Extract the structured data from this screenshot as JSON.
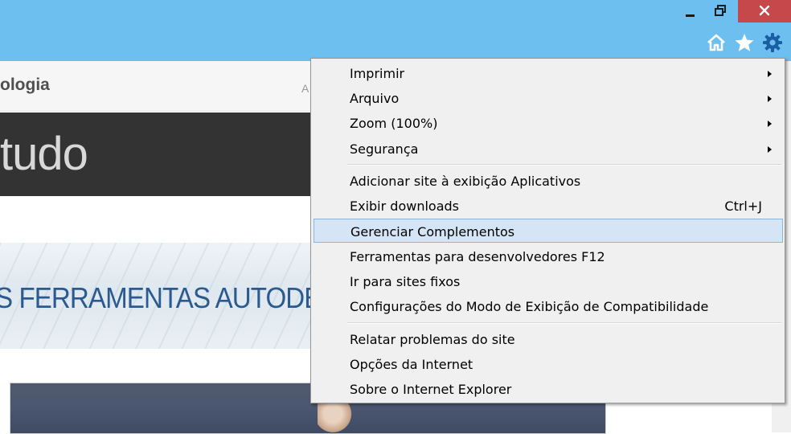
{
  "colors": {
    "titlebar": "#6cbfee",
    "close_button": "#c7484a",
    "menu_background": "#f0f0f0",
    "menu_highlight": "#d5e5f6",
    "banner_text": "#2a5a8f"
  },
  "window_controls": {
    "minimize_icon": "minimize-icon",
    "restore_icon": "restore-icon",
    "close_icon": "close-icon"
  },
  "command_bar": {
    "home_icon": "home-icon",
    "favorites_icon": "star-icon",
    "tools_icon": "gear-icon"
  },
  "page": {
    "brand_fragment": "ologia",
    "nav_fragment": "A",
    "dark_banner_text": "tudo",
    "ad_banner_text": "S FERRAMENTAS AUTODESK"
  },
  "menu": {
    "group1": [
      {
        "label": "Imprimir",
        "submenu": true
      },
      {
        "label": "Arquivo",
        "submenu": true
      },
      {
        "label": "Zoom (100%)",
        "submenu": true
      },
      {
        "label": "Segurança",
        "submenu": true
      }
    ],
    "group2": [
      {
        "label": "Adicionar site à exibição Aplicativos"
      },
      {
        "label": "Exibir downloads",
        "shortcut": "Ctrl+J"
      },
      {
        "label": "Gerenciar Complementos",
        "highlighted": true
      },
      {
        "label": "Ferramentas para desenvolvedores F12"
      },
      {
        "label": "Ir para sites fixos"
      },
      {
        "label": "Configurações do Modo de Exibição de Compatibilidade"
      }
    ],
    "group3": [
      {
        "label": "Relatar problemas do site"
      },
      {
        "label": "Opções da Internet"
      },
      {
        "label": "Sobre o Internet Explorer"
      }
    ]
  }
}
